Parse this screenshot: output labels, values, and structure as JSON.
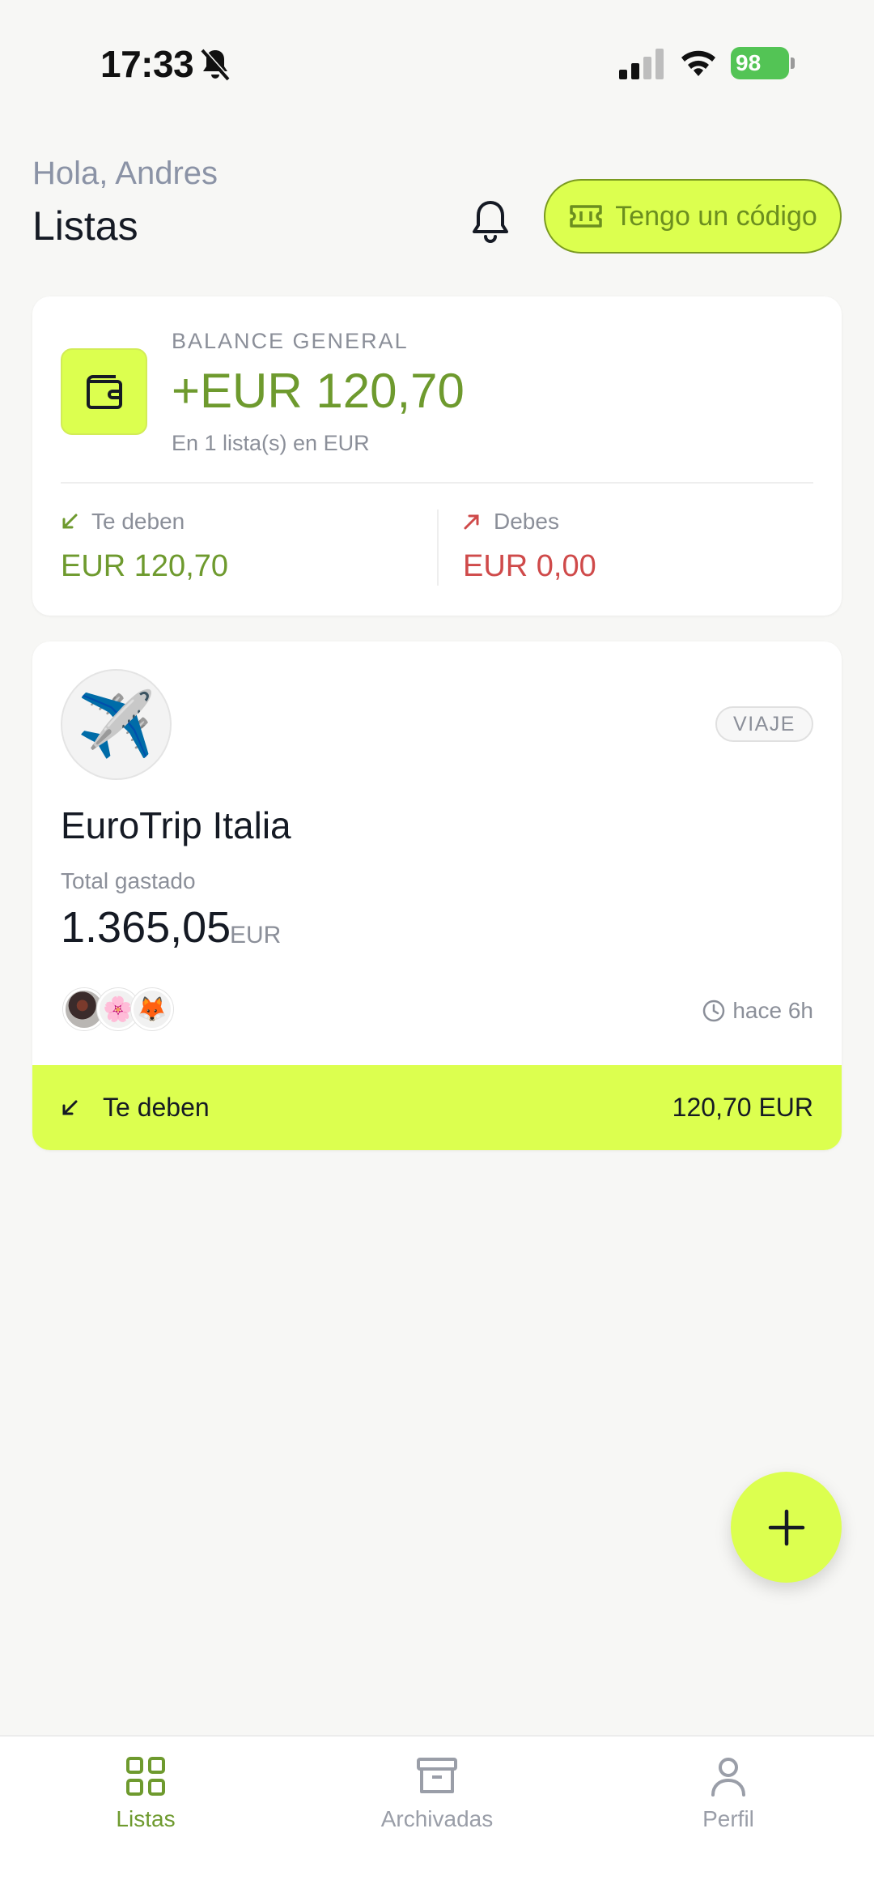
{
  "status_bar": {
    "time": "17:33",
    "battery": "98"
  },
  "header": {
    "greeting": "Hola, Andres",
    "title": "Listas",
    "code_button_label": "Tengo un código"
  },
  "balance": {
    "label": "BALANCE GENERAL",
    "amount": "+EUR 120,70",
    "subtitle": "En 1 lista(s) en EUR",
    "owed_to_you_label": "Te deben",
    "owed_to_you_amount": "EUR 120,70",
    "you_owe_label": "Debes",
    "you_owe_amount": "EUR 0,00"
  },
  "lists": [
    {
      "emoji": "✈️",
      "tag": "VIAJE",
      "name": "EuroTrip Italia",
      "total_label": "Total gastado",
      "total": "1.365,05",
      "currency": "EUR",
      "members": [
        "photo",
        "🌸",
        "🦊"
      ],
      "last_update": "hace 6h",
      "footer_label": "Te deben",
      "footer_amount": "120,70 EUR"
    }
  ],
  "tabs": [
    {
      "label": "Listas",
      "icon": "grid-icon",
      "active": true
    },
    {
      "label": "Archivadas",
      "icon": "archive-icon",
      "active": false
    },
    {
      "label": "Perfil",
      "icon": "user-icon",
      "active": false
    }
  ],
  "colors": {
    "accent": "#dcff4f",
    "positive": "#6e9a2e",
    "negative": "#cf4a4a",
    "background": "#f7f7f5"
  }
}
